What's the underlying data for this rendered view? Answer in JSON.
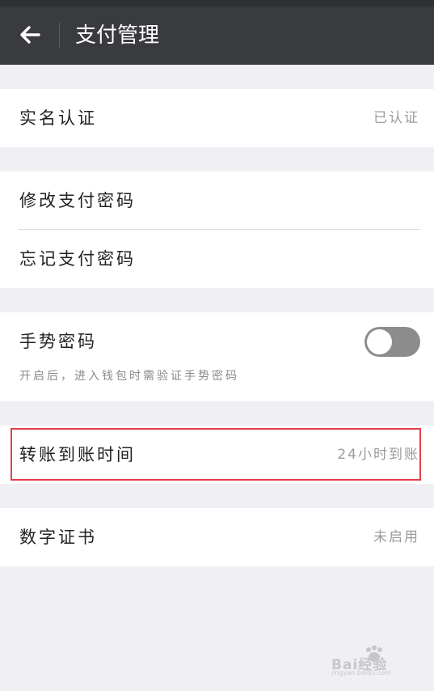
{
  "header": {
    "title": "支付管理",
    "back_icon": "arrow-left-icon"
  },
  "sections": {
    "realname": {
      "label": "实名认证",
      "value": "已认证"
    },
    "change_pwd": {
      "label": "修改支付密码"
    },
    "forgot_pwd": {
      "label": "忘记支付密码"
    },
    "gesture": {
      "label": "手势密码",
      "hint": "开启后，进入钱包时需验证手势密码",
      "toggle_on": false
    },
    "transfer_time": {
      "label": "转账到账时间",
      "value": "24小时到账"
    },
    "certificate": {
      "label": "数字证书",
      "value": "未启用"
    }
  },
  "highlight_color": "#e43f4a",
  "watermark": {
    "text": "Bai经验",
    "sub": "jingyan.baidu.com"
  }
}
